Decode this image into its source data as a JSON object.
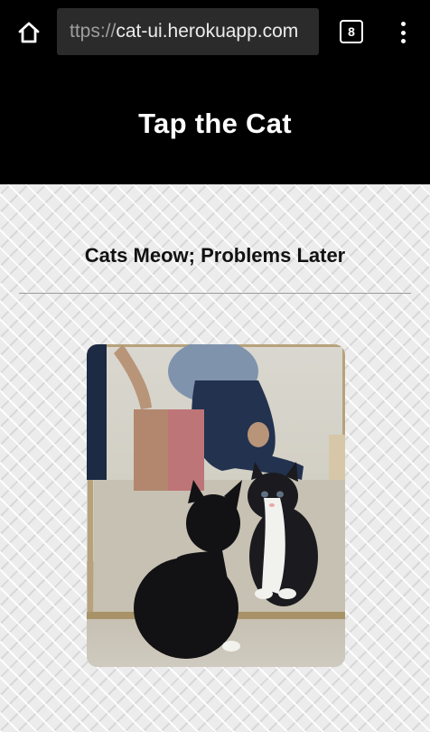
{
  "browser": {
    "url_scheme": "ttps://",
    "url_host": "cat-ui.herokuapp.com",
    "tab_count": "8",
    "icons": {
      "home": "home-icon",
      "tabs": "tab-switcher-icon",
      "menu": "more-vert-icon"
    }
  },
  "page": {
    "title": "Tap the Cat",
    "subtitle": "Cats Meow; Problems Later"
  },
  "colors": {
    "header_bg": "#000000",
    "content_bg": "#ececec"
  }
}
